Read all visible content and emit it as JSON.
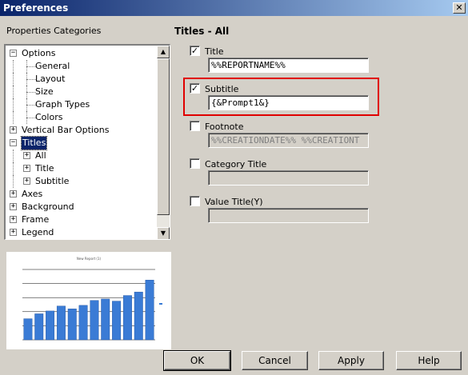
{
  "window": {
    "title": "Preferences",
    "close_glyph": "✕"
  },
  "left": {
    "categories_label": "Properties Categories",
    "tree": [
      {
        "label": "Options",
        "level": 0,
        "expander": "−"
      },
      {
        "label": "General",
        "level": 1
      },
      {
        "label": "Layout",
        "level": 1
      },
      {
        "label": "Size",
        "level": 1
      },
      {
        "label": "Graph Types",
        "level": 1
      },
      {
        "label": "Colors",
        "level": 1
      },
      {
        "label": "Vertical Bar Options",
        "level": 0,
        "expander": "+"
      },
      {
        "label": "Titles",
        "level": 0,
        "expander": "−",
        "selected": true
      },
      {
        "label": "All",
        "level": 1,
        "expander": "+"
      },
      {
        "label": "Title",
        "level": 1,
        "expander": "+"
      },
      {
        "label": "Subtitle",
        "level": 1,
        "expander": "+"
      },
      {
        "label": "Axes",
        "level": 0,
        "expander": "+"
      },
      {
        "label": "Background",
        "level": 0,
        "expander": "+"
      },
      {
        "label": "Frame",
        "level": 0,
        "expander": "+"
      },
      {
        "label": "Legend",
        "level": 0,
        "expander": "+"
      }
    ],
    "scroll_up_icon": "▲",
    "scroll_down_icon": "▼"
  },
  "preview": {
    "chart_data": {
      "type": "bar",
      "title": "New Report (1)",
      "values": [
        30,
        37,
        41,
        48,
        44,
        49,
        56,
        58,
        55,
        63,
        68,
        85
      ],
      "ylim": [
        0,
        100
      ],
      "bar_color": "#3a7bd5",
      "legend_placement": "right"
    }
  },
  "right": {
    "section_title": "Titles - All",
    "fields": [
      {
        "label": "Title",
        "checked": true,
        "value": "%%REPORTNAME%%",
        "disabled": false
      },
      {
        "label": "Subtitle",
        "checked": true,
        "value": "{&Prompt1&}",
        "disabled": false
      },
      {
        "label": "Footnote",
        "checked": false,
        "value": "%%CREATIONDATE%% %%CREATIONT",
        "disabled": true
      },
      {
        "label": "Category Title",
        "checked": false,
        "value": "",
        "disabled": true
      },
      {
        "label": "Value Title(Y)",
        "checked": false,
        "value": "",
        "disabled": true
      }
    ]
  },
  "buttons": {
    "ok": "OK",
    "cancel": "Cancel",
    "apply": "Apply",
    "help": "Help"
  }
}
